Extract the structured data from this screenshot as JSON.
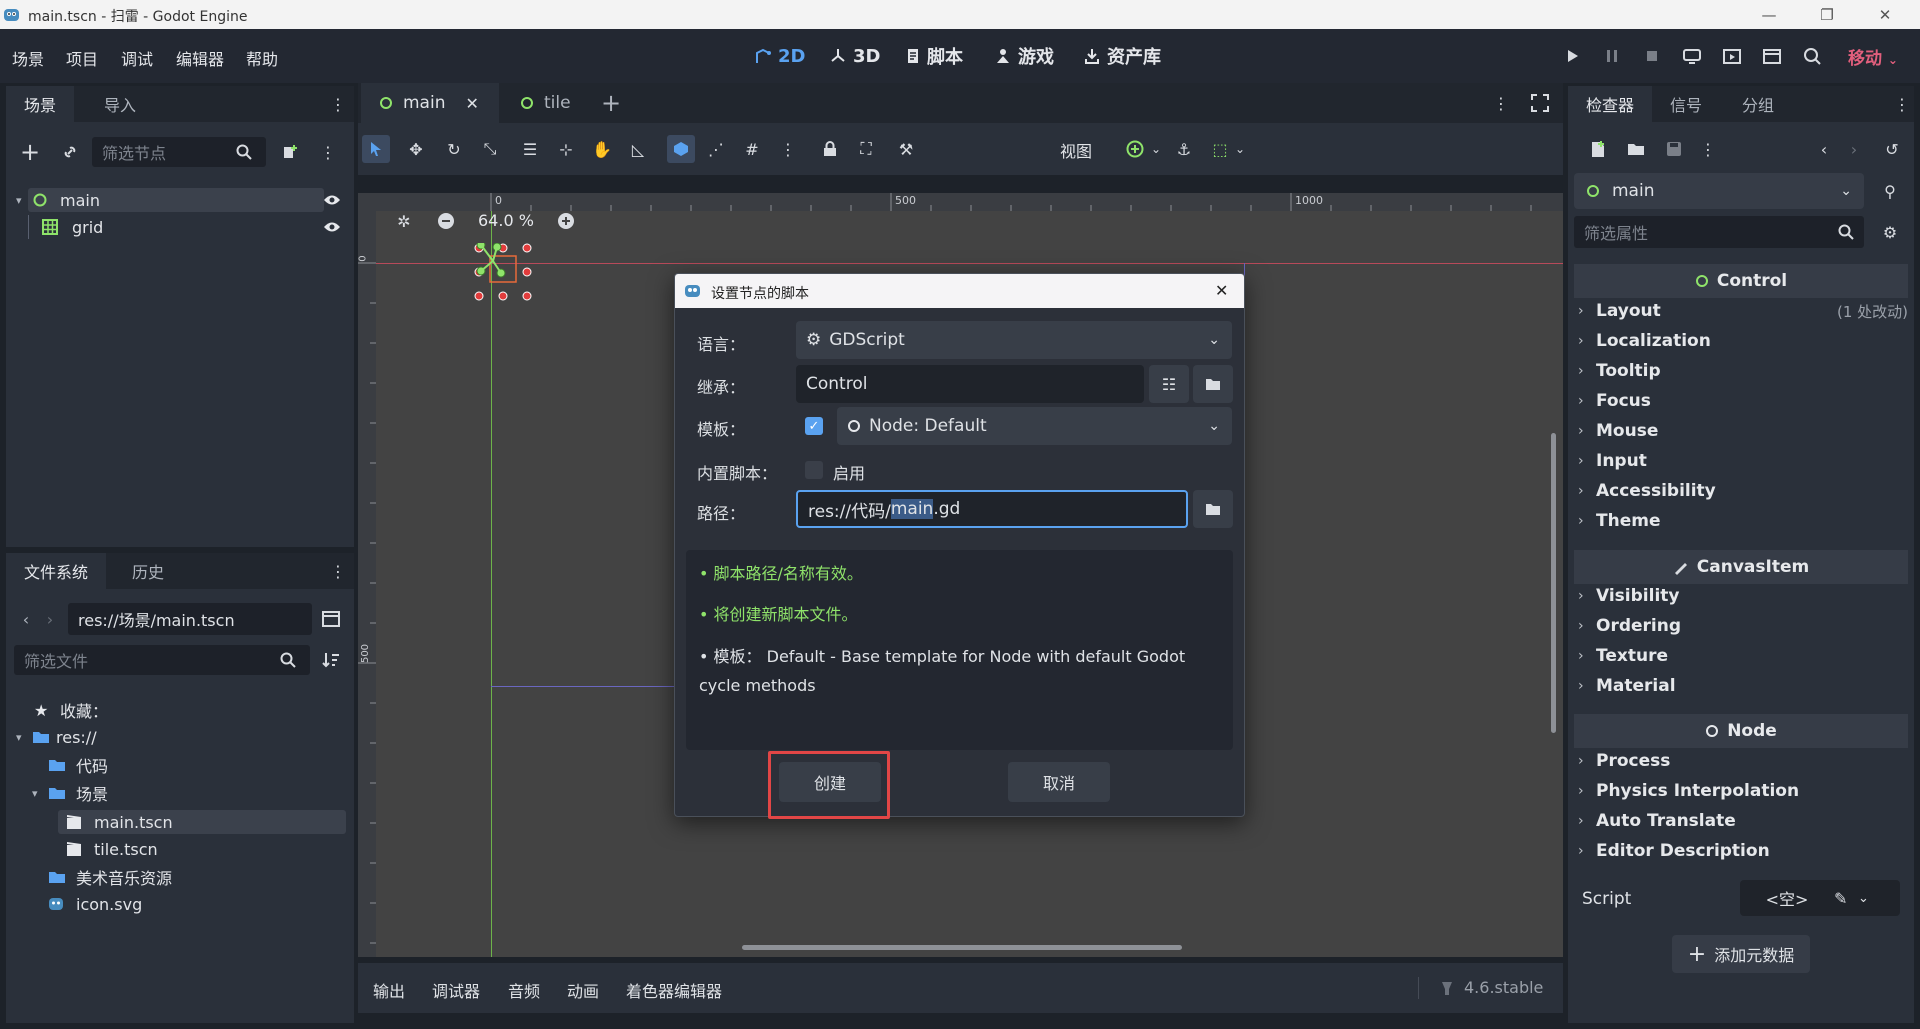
{
  "window": {
    "title": "main.tscn - 扫雷 - Godot Engine",
    "controls": [
      "—",
      "❐",
      "✕"
    ]
  },
  "menubar": [
    "场景",
    "项目",
    "调试",
    "编辑器",
    "帮助"
  ],
  "workspaces": [
    {
      "icon": "2d-icon",
      "label": "2D",
      "active": true
    },
    {
      "icon": "3d-icon",
      "label": "3D",
      "active": false
    },
    {
      "icon": "script-icon",
      "label": "脚本",
      "active": false
    },
    {
      "icon": "game-icon",
      "label": "游戏",
      "active": false
    },
    {
      "icon": "assetlib-icon",
      "label": "资产库",
      "active": false
    }
  ],
  "renderer": "移动",
  "scene_dock": {
    "tabs": [
      "场景",
      "导入"
    ],
    "filter_placeholder": "筛选节点",
    "nodes": [
      {
        "name": "main",
        "type": "control",
        "selected": true
      },
      {
        "name": "grid",
        "type": "gridcontainer",
        "selected": false
      }
    ]
  },
  "filesystem_dock": {
    "tabs": [
      "文件系统",
      "历史"
    ],
    "path": "res://场景/main.tscn",
    "filter_placeholder": "筛选文件",
    "favorites": "收藏：",
    "items": [
      {
        "label": "res://",
        "kind": "folder",
        "depth": 0
      },
      {
        "label": "代码",
        "kind": "folder",
        "depth": 1
      },
      {
        "label": "场景",
        "kind": "folder",
        "depth": 1
      },
      {
        "label": "main.tscn",
        "kind": "scene",
        "depth": 2,
        "selected": true
      },
      {
        "label": "tile.tscn",
        "kind": "scene",
        "depth": 2
      },
      {
        "label": "美术音乐资源",
        "kind": "folder",
        "depth": 1
      },
      {
        "label": "icon.svg",
        "kind": "image",
        "depth": 1
      }
    ]
  },
  "editor_tabs": [
    {
      "label": "main",
      "active": true
    },
    {
      "label": "tile",
      "active": false
    }
  ],
  "toolbar": {
    "view_label": "视图"
  },
  "viewport": {
    "zoom": "64.0 %",
    "ruler_top": [
      "0",
      "500",
      "1000"
    ],
    "ruler_left": [
      "0",
      "500"
    ]
  },
  "bottom_panel": {
    "tabs": [
      "输出",
      "调试器",
      "音频",
      "动画",
      "着色器编辑器"
    ],
    "version": "4.6.stable"
  },
  "dialog": {
    "title": "设置节点的脚本",
    "language_label": "语言：",
    "language_value": "GDScript",
    "inherits_label": "继承：",
    "inherits_value": "Control",
    "template_label": "模板：",
    "template_checked": true,
    "template_value": "Node: Default",
    "builtin_label": "内置脚本：",
    "builtin_checked": false,
    "builtin_text": "启用",
    "path_label": "路径：",
    "path_prefix": "res://代码/",
    "path_selected": "main",
    "path_suffix": ".gd",
    "messages": [
      {
        "text": "脚本路径/名称有效。",
        "color": "#8fe36a"
      },
      {
        "text": "将创建新脚本文件。",
        "color": "#8fe36a"
      },
      {
        "text": "模板： Default - Base template for Node with default Godot cycle methods",
        "color": "#dfe2e6"
      }
    ],
    "create_label": "创建",
    "cancel_label": "取消"
  },
  "inspector": {
    "tabs": [
      "检查器",
      "信号",
      "分组"
    ],
    "node_name": "main",
    "filter_placeholder": "筛选属性",
    "sections": [
      {
        "title": "Control",
        "icon": "control-icon",
        "props": [
          {
            "name": "Layout",
            "note": "(1 处改动)"
          },
          {
            "name": "Localization"
          },
          {
            "name": "Tooltip"
          },
          {
            "name": "Focus"
          },
          {
            "name": "Mouse"
          },
          {
            "name": "Input"
          },
          {
            "name": "Accessibility"
          },
          {
            "name": "Theme"
          }
        ]
      },
      {
        "title": "CanvasItem",
        "icon": "canvasitem-icon",
        "props": [
          {
            "name": "Visibility"
          },
          {
            "name": "Ordering"
          },
          {
            "name": "Texture"
          },
          {
            "name": "Material"
          }
        ]
      },
      {
        "title": "Node",
        "icon": "node-icon",
        "props": [
          {
            "name": "Process"
          },
          {
            "name": "Physics Interpolation"
          },
          {
            "name": "Auto Translate"
          },
          {
            "name": "Editor Description"
          }
        ]
      }
    ],
    "script_label": "Script",
    "script_value": "<空>",
    "add_metadata": "添加元数据"
  },
  "colors": {
    "accent": "#5aa2f0",
    "highlight_box": "#e24646",
    "renderer": "#e25f7d"
  }
}
